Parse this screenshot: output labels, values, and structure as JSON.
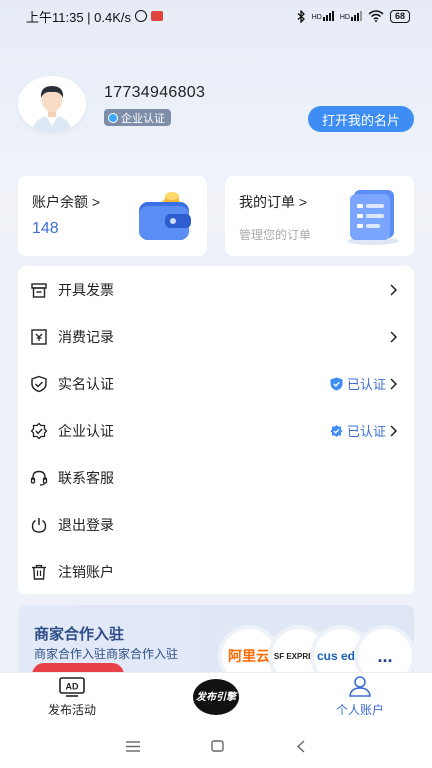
{
  "status_bar": {
    "time_text": "上午11:35 | 0.4K/s",
    "signal_1": "HD",
    "signal_2": "HD",
    "battery": "68"
  },
  "profile": {
    "phone": "17734946803",
    "badge_label": "企业认证",
    "card_button": "打开我的名片"
  },
  "stats": {
    "balance_title": "账户余额 >",
    "balance_value": "148",
    "orders_title": "我的订单 >",
    "orders_sub": "管理您的订单"
  },
  "menu": {
    "items": [
      {
        "label": "开具发票",
        "icon": "invoice-icon"
      },
      {
        "label": "消费记录",
        "icon": "receipt-icon"
      },
      {
        "label": "实名认证",
        "icon": "shield-check-icon",
        "status": "已认证"
      },
      {
        "label": "企业认证",
        "icon": "badge-check-icon",
        "status": "已认证"
      },
      {
        "label": "联系客服",
        "icon": "headset-icon"
      },
      {
        "label": "退出登录",
        "icon": "power-icon"
      },
      {
        "label": "注销账户",
        "icon": "trash-icon"
      }
    ]
  },
  "banner": {
    "title": "商家合作入驻",
    "subtitle": "商家合作入驻商家合作入驻",
    "logos": [
      "阿里云",
      "SF EXPRESS",
      "cus edia",
      "..."
    ]
  },
  "tabbar": {
    "items": [
      {
        "label": "发布活动",
        "icon": "ad-icon"
      },
      {
        "label": "",
        "icon": "publish-engine-logo",
        "logo_text": "发布引擎"
      },
      {
        "label": "个人账户",
        "icon": "user-icon"
      }
    ]
  },
  "colors": {
    "accent": "#3d8df5",
    "link_blue": "#3d6ed8",
    "banner_title": "#2d4e86",
    "badge_bg": "#7f8ea8"
  }
}
